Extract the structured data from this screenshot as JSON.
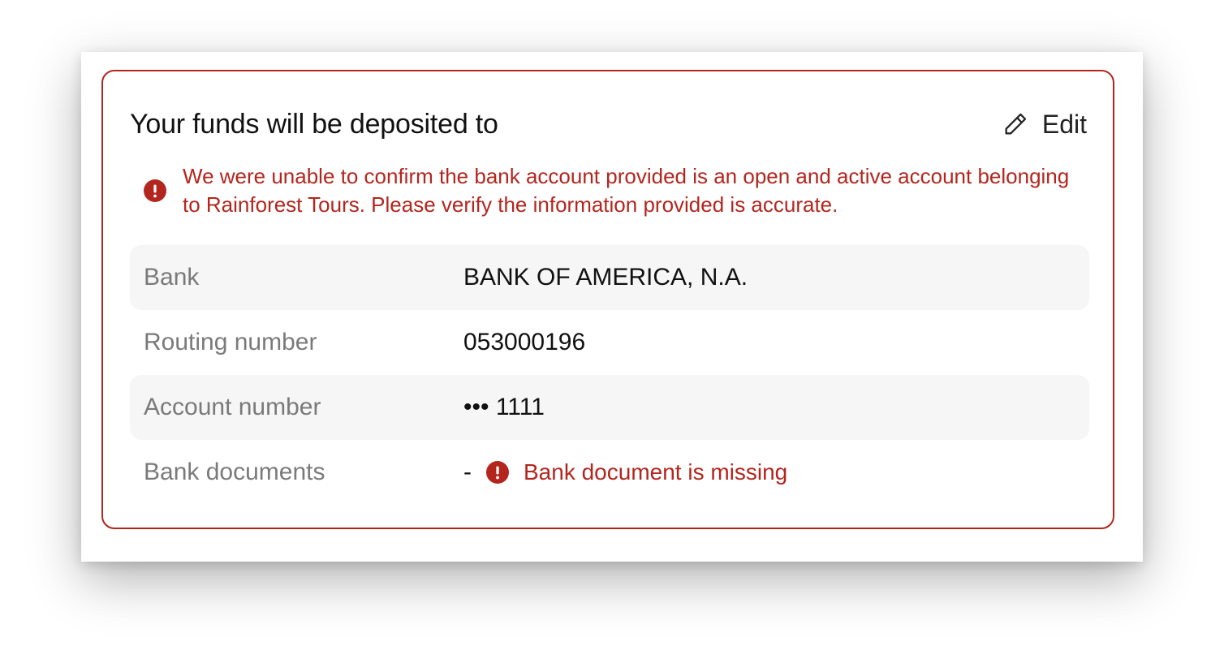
{
  "card": {
    "title": "Your funds will be deposited to",
    "edit_label": "Edit"
  },
  "alert": {
    "message": "We were unable to confirm the bank account provided is an open and active account belonging to Rainforest Tours. Please verify the information provided is accurate."
  },
  "details": {
    "bank": {
      "label": "Bank",
      "value": "BANK OF AMERICA, N.A."
    },
    "routing": {
      "label": "Routing number",
      "value": "053000196"
    },
    "account": {
      "label": "Account number",
      "value": "••• 1111"
    },
    "documents": {
      "label": "Bank documents",
      "value": "-",
      "error": "Bank document is missing"
    }
  },
  "colors": {
    "error": "#b3261e",
    "row_shade": "#f6f6f6",
    "label": "#7a7a7a",
    "text": "#111111"
  },
  "icons": {
    "edit": "pencil-icon",
    "alert": "exclamation-circle-icon"
  }
}
